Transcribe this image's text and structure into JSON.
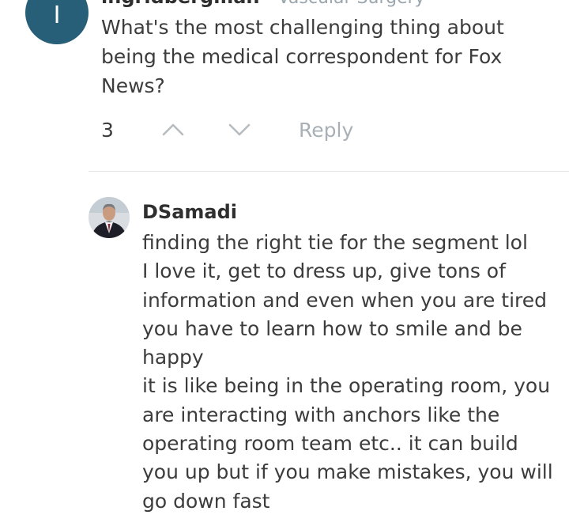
{
  "question": {
    "avatar_initial": "I",
    "username": "ingridbergman",
    "specialty": "Vascular Surgery",
    "text": "What's the most challenging thing about being the medical correspondent for Fox News?",
    "vote_count": "3",
    "reply_label": "Reply"
  },
  "answer": {
    "username": "DSamadi",
    "lines": [
      "finding the right tie for the segment  lol",
      "I love it, get to dress up, give tons of",
      "information and even when you are tired",
      "you have to learn how to smile and be",
      "happy",
      "it is like being in the operating room, you",
      "are interacting with anchors like the",
      "operating room team etc.. it can build",
      "you up but if you make mistakes, you will",
      "go down fast"
    ]
  },
  "colors": {
    "avatar_bg": "#285f78",
    "muted_text": "#9aa6ad",
    "divider": "#e3e3e3"
  },
  "icons": [
    "chevron-up-icon",
    "chevron-down-icon"
  ]
}
